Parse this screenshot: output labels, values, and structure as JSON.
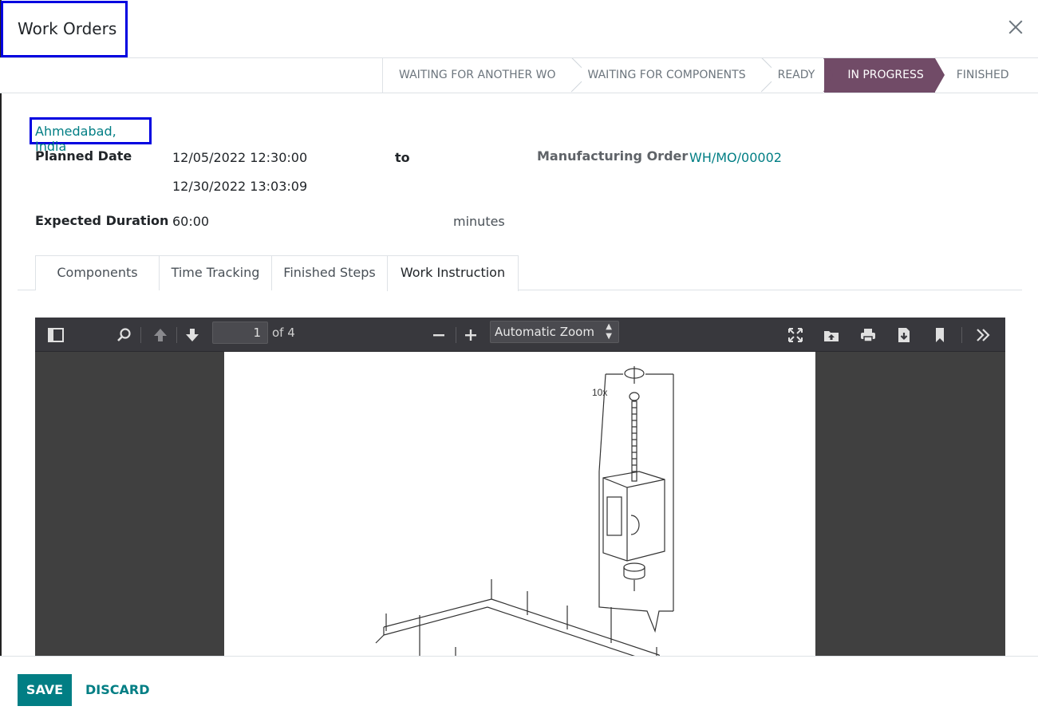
{
  "dialog": {
    "title": "Work Orders"
  },
  "statusbar": {
    "stages": [
      "WAITING FOR ANOTHER WO",
      "WAITING FOR COMPONENTS",
      "READY",
      "IN PROGRESS",
      "FINISHED"
    ],
    "active_stage": "IN PROGRESS"
  },
  "form": {
    "workcenter_location": "Ahmedabad, India",
    "planned_date_label": "Planned Date",
    "planned_date_start": "12/05/2022 12:30:00",
    "to_label": "to",
    "planned_date_end": "12/30/2022 13:03:09",
    "mo_label": "Manufacturing Order",
    "mo_value": "WH/MO/00002",
    "duration_label": "Expected Duration",
    "duration_value": "60:00",
    "duration_unit": "minutes"
  },
  "tabs": [
    "Components",
    "Time Tracking",
    "Finished Steps",
    "Work Instruction"
  ],
  "active_tab": "Work Instruction",
  "pdf_viewer": {
    "page_number": "1",
    "page_count_text": "of 4",
    "zoom": "Automatic Zoom",
    "drawing_label": "10x"
  },
  "footer": {
    "save_label": "SAVE",
    "discard_label": "DISCARD"
  },
  "colors": {
    "accent": "#714b67",
    "link": "#017e84",
    "highlight_border": "#0000e0"
  }
}
